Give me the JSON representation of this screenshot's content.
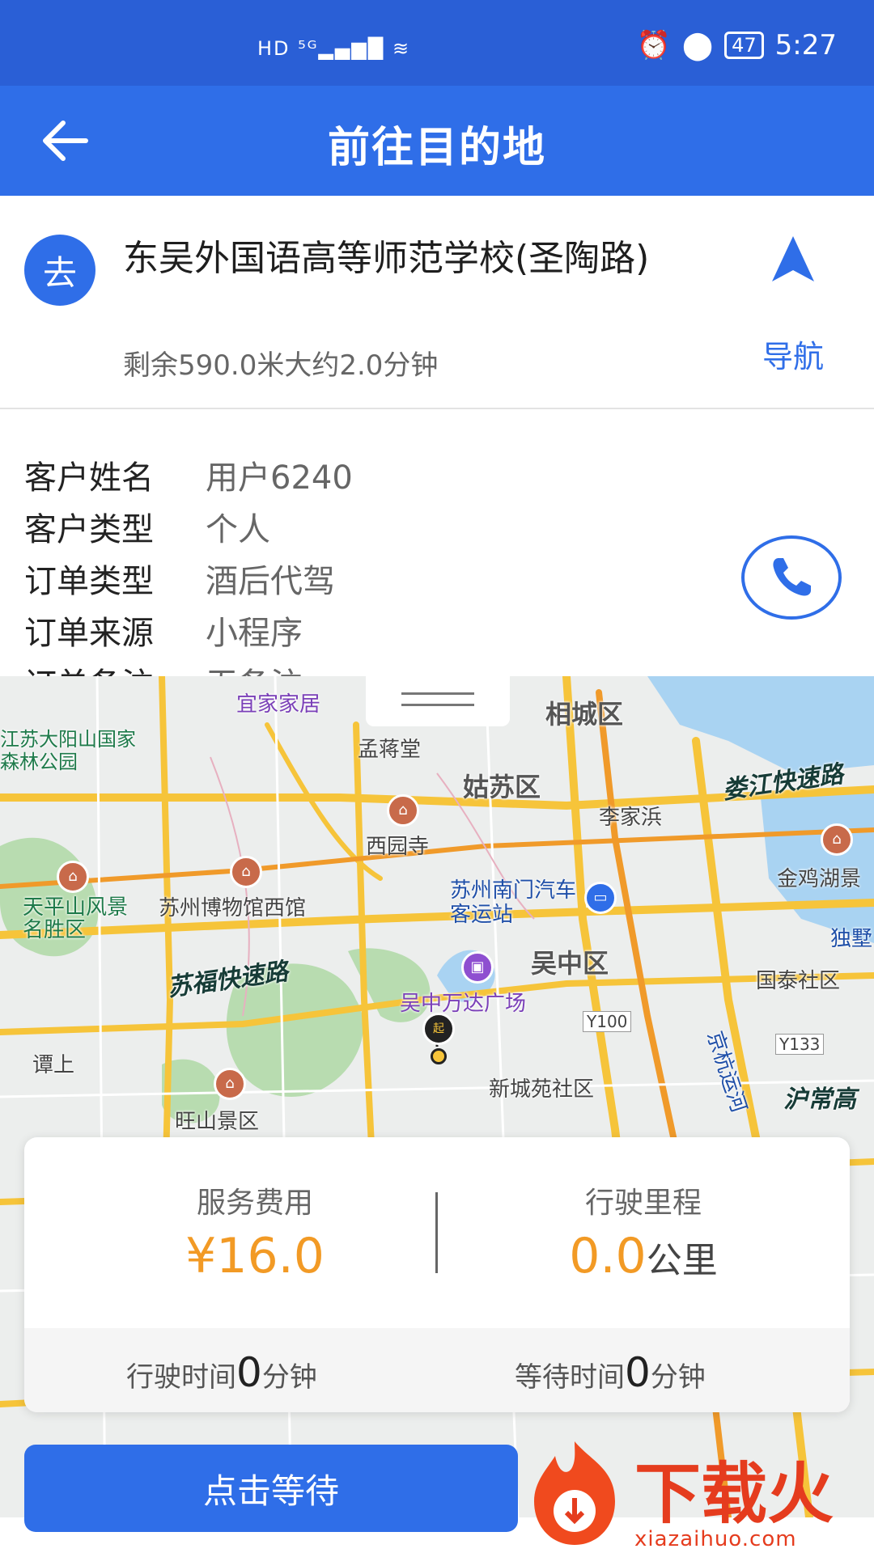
{
  "status_bar": {
    "left_icons": "HD ⁵ᴳ▂▄▆█ ≋",
    "battery": "47",
    "time": "5:27"
  },
  "header": {
    "title": "前往目的地"
  },
  "destination": {
    "badge": "去",
    "name": "东吴外国语高等师范学校(圣陶路)",
    "remain": "剩余590.0米大约2.0分钟",
    "nav_label": "导航"
  },
  "customer": {
    "rows": [
      {
        "key": "客户姓名",
        "value": "用户6240"
      },
      {
        "key": "客户类型",
        "value": "个人"
      },
      {
        "key": "订单类型",
        "value": "酒后代驾"
      },
      {
        "key": "订单来源",
        "value": "小程序"
      },
      {
        "key": "订单备注",
        "value": "无备注"
      }
    ]
  },
  "map": {
    "labels": {
      "yijia": "宜家家居",
      "xiangcheng": "相城区",
      "taiyang": "江苏大阳山国家森林公园",
      "mengjiang": "孟蒋堂",
      "gusu": "姑苏区",
      "loujiang": "娄江快速路",
      "lijiabang": "李家浜",
      "xiyuan": "西园寺",
      "jinjihu": "金鸡湖景",
      "museum": "苏州博物馆西馆",
      "nanmen": "苏州南门汽车客运站",
      "tianping": "天平山风景名胜区",
      "dushu": "独墅",
      "sufu": "苏福快速路",
      "wuzhong": "吴中区",
      "guotai": "国泰社区",
      "wanda": "吴中万达广场",
      "y100": "Y100",
      "y133": "Y133",
      "jinghang": "京杭运河",
      "tanshang": "谭上",
      "xinchengyuan": "新城苑社区",
      "huchang": "沪常高",
      "wangshan": "旺山景区",
      "start": "起"
    }
  },
  "stats": {
    "fee_label": "服务费用",
    "fee_value": "¥16.0",
    "distance_label": "行驶里程",
    "distance_value": "0.0",
    "distance_unit": "公里",
    "drive_time_prefix": "行驶时间",
    "drive_time_value": "0",
    "drive_time_unit": "分钟",
    "wait_time_prefix": "等待时间",
    "wait_time_value": "0",
    "wait_time_unit": "分钟"
  },
  "actions": {
    "wait_button": "点击等待"
  },
  "watermark": {
    "brand": "下载火",
    "url": "xiazaihuo.com"
  },
  "colors": {
    "primary": "#2f6ee8",
    "status_bar": "#2a5fd6",
    "accent": "#f29a25"
  }
}
